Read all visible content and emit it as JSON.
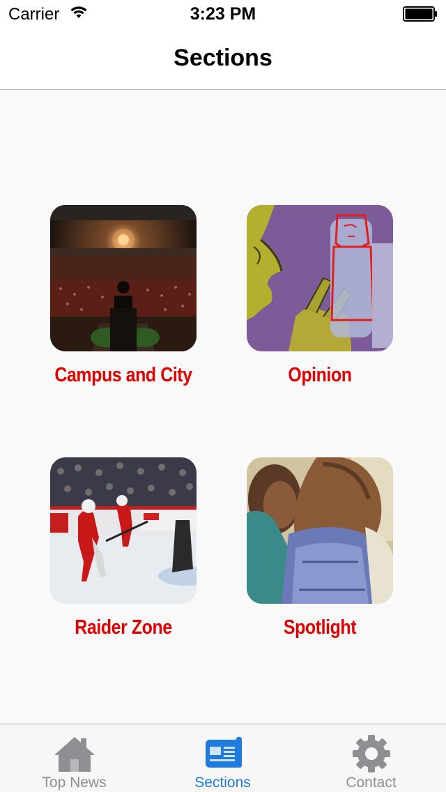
{
  "status_bar": {
    "carrier": "Carrier",
    "time": "3:23 PM"
  },
  "nav": {
    "title": "Sections"
  },
  "sections": [
    {
      "label": "Campus and City",
      "icon": "auditorium-photo"
    },
    {
      "label": "Opinion",
      "icon": "opinion-illustration"
    },
    {
      "label": "Raider Zone",
      "icon": "hockey-photo"
    },
    {
      "label": "Spotlight",
      "icon": "students-photo"
    }
  ],
  "tabs": [
    {
      "label": "Top News",
      "icon": "house-icon",
      "active": false
    },
    {
      "label": "Sections",
      "icon": "newspaper-icon",
      "active": true
    },
    {
      "label": "Contact",
      "icon": "gear-icon",
      "active": false
    }
  ],
  "colors": {
    "section_label": "#e00000",
    "tab_active": "#1e7be0",
    "tab_inactive": "#8e8e93"
  }
}
